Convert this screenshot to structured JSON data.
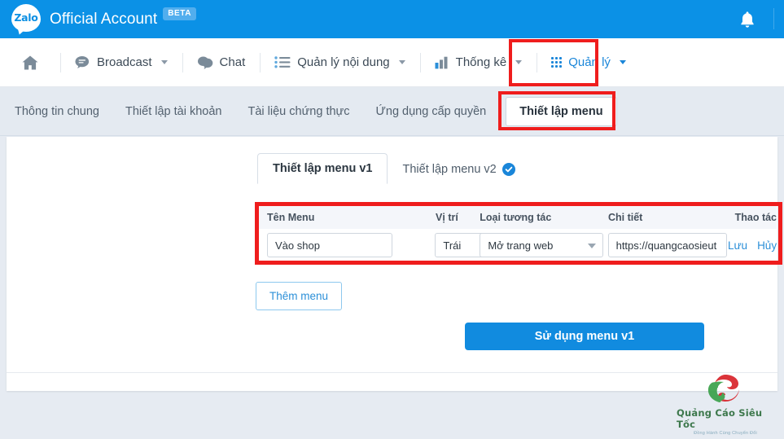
{
  "header": {
    "logo_text": "Zalo",
    "brand_title": "Official Account",
    "badge": "BETA",
    "bell_icon": "bell-icon"
  },
  "main_nav": {
    "home_icon": "home-icon",
    "items": [
      {
        "label": "Broadcast",
        "icon": "broadcast-icon",
        "has_caret": true,
        "active": false
      },
      {
        "label": "Chat",
        "icon": "chat-icon",
        "has_caret": false,
        "active": false
      },
      {
        "label": "Quản lý nội dung",
        "icon": "list-icon",
        "has_caret": true,
        "active": false
      },
      {
        "label": "Thống kê",
        "icon": "bar-chart-icon",
        "has_caret": true,
        "active": false
      },
      {
        "label": "Quản lý",
        "icon": "grid-icon",
        "has_caret": true,
        "active": true
      }
    ]
  },
  "sub_nav": {
    "items": [
      {
        "label": "Thông tin chung",
        "active": false
      },
      {
        "label": "Thiết lập tài khoản",
        "active": false
      },
      {
        "label": "Tài liệu chứng thực",
        "active": false
      },
      {
        "label": "Ứng dụng cấp quyền",
        "active": false
      },
      {
        "label": "Thiết lập menu",
        "active": true
      }
    ]
  },
  "tabs": [
    {
      "label": "Thiết lập menu v1",
      "active": true,
      "badge": false
    },
    {
      "label": "Thiết lập menu v2",
      "active": false,
      "badge": true
    }
  ],
  "menu_table": {
    "columns": [
      "Tên Menu",
      "Vị trí",
      "Loại tương tác",
      "Chi tiết",
      "Thao tác"
    ],
    "rows": [
      {
        "name": "Vào shop",
        "position": "Trái",
        "interaction_type": "Mở trang web",
        "detail": "https://quangcaosieut",
        "actions": [
          "Lưu",
          "Hủy"
        ]
      }
    ]
  },
  "buttons": {
    "add_menu": "Thêm menu",
    "use_menu": "Sử dụng menu v1"
  },
  "watermark": {
    "title": "Quảng Cáo Siêu Tốc",
    "tagline": "Đồng Hành Cùng Chuyển Đổi"
  },
  "colors": {
    "brand_blue": "#0b91e6",
    "accent_blue": "#118bdf",
    "link_blue": "#2b8fd8",
    "highlight_red": "#ef1d1d",
    "subnav_bg": "#e4eaf1",
    "page_bg": "#e6ebf2"
  }
}
